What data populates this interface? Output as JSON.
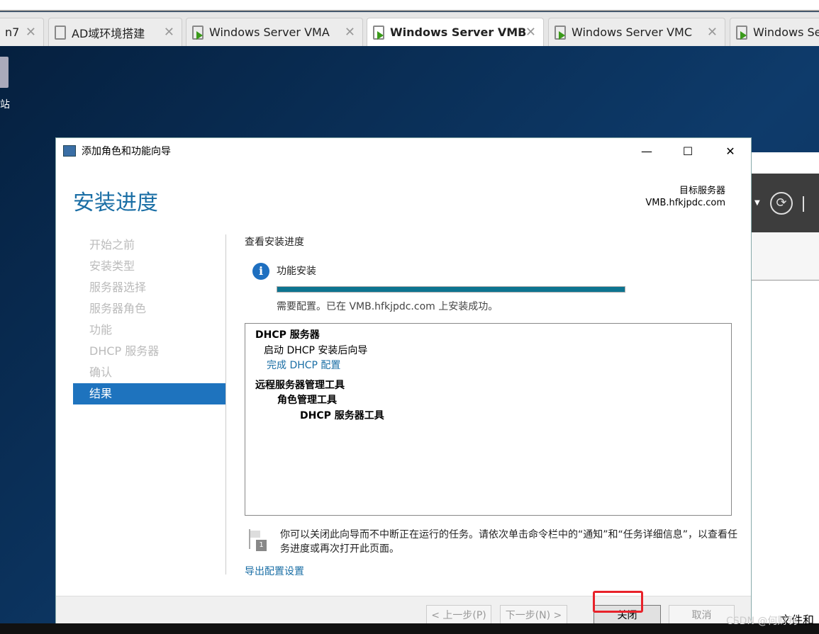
{
  "tabs": [
    {
      "label": "n7"
    },
    {
      "label": "AD域环境搭建"
    },
    {
      "label": "Windows Server VMA"
    },
    {
      "label": "Windows Server VMB",
      "active": true
    },
    {
      "label": "Windows Server VMC"
    },
    {
      "label": "Windows Se"
    }
  ],
  "desktop": {
    "recycle_label": "站"
  },
  "dialog": {
    "title": "添加角色和功能向导",
    "page_title": "安装进度",
    "target_label": "目标服务器",
    "target_server": "VMB.hfkjpdc.com",
    "nav": [
      "开始之前",
      "安装类型",
      "服务器选择",
      "服务器角色",
      "功能",
      "DHCP 服务器",
      "确认",
      "结果"
    ],
    "active_nav": "结果",
    "view_label": "查看安装进度",
    "feature_label": "功能安装",
    "progress_percent": 100,
    "status_text": "需要配置。已在 VMB.hfkjpdc.com 上安装成功。",
    "results": [
      {
        "text": "DHCP 服务器",
        "level": 0,
        "bold": true
      },
      {
        "text": "启动 DHCP 安装后向导",
        "level": 1
      },
      {
        "text": "完成 DHCP 配置",
        "level": 1,
        "link": true
      },
      {
        "text": "远程服务器管理工具",
        "level": 0,
        "bold": true
      },
      {
        "text": "角色管理工具",
        "level": 2,
        "bold": true
      },
      {
        "text": "DHCP 服务器工具",
        "level": 3,
        "bold": true
      }
    ],
    "note": "你可以关闭此向导而不中断正在运行的任务。请依次单击命令栏中的“通知”和“任务详细信息”，以查看任务进度或再次打开此页面。",
    "flag_badge": "1",
    "export_link": "导出配置设置",
    "buttons": {
      "prev": "< 上一步(P)",
      "next": "下一步(N) >",
      "close": "关闭",
      "cancel": "取消"
    }
  },
  "background": {
    "files_label": "文件和",
    "watermark": "CSDN @何财钊"
  },
  "colors": {
    "accent": "#1e73be",
    "progress": "#0d7490",
    "highlight": "#e8222a"
  }
}
